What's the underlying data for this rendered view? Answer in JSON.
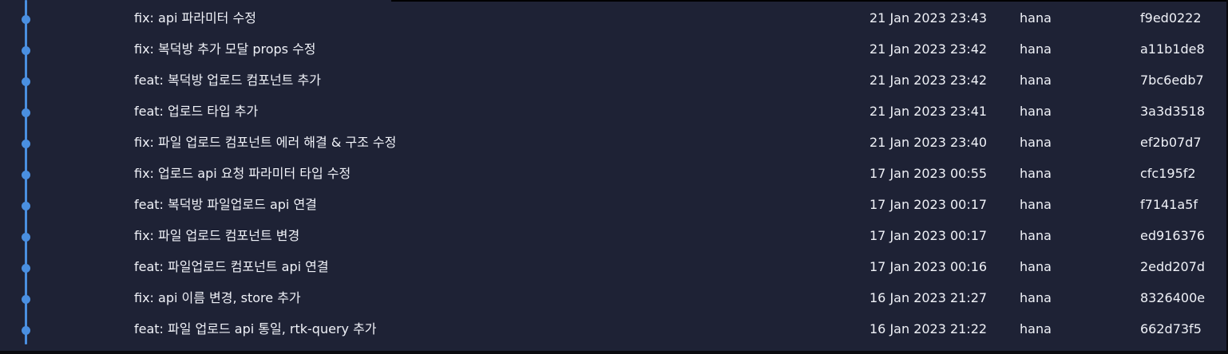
{
  "colors": {
    "background": "#1e2235",
    "graph": "#4a8fe0",
    "text": "#f0f2f8"
  },
  "commits": [
    {
      "message": "fix: api 파라미터 수정",
      "date": "21 Jan 2023 23:43",
      "author": "hana",
      "hash": "f9ed0222"
    },
    {
      "message": "fix: 복덕방 추가 모달 props 수정",
      "date": "21 Jan 2023 23:42",
      "author": "hana",
      "hash": "a11b1de8"
    },
    {
      "message": "feat: 복덕방 업로드 컴포넌트 추가",
      "date": "21 Jan 2023 23:42",
      "author": "hana",
      "hash": "7bc6edb7"
    },
    {
      "message": "feat: 업로드 타입 추가",
      "date": "21 Jan 2023 23:41",
      "author": "hana",
      "hash": "3a3d3518"
    },
    {
      "message": "fix: 파일 업로드 컴포넌트 에러 해결 & 구조 수정",
      "date": "21 Jan 2023 23:40",
      "author": "hana",
      "hash": "ef2b07d7"
    },
    {
      "message": "fix: 업로드 api 요청 파라미터 타입 수정",
      "date": "17 Jan 2023 00:55",
      "author": "hana",
      "hash": "cfc195f2"
    },
    {
      "message": "feat: 복덕방 파일업로드 api 연결",
      "date": "17 Jan 2023 00:17",
      "author": "hana",
      "hash": "f7141a5f"
    },
    {
      "message": "fix: 파일 업로드 컴포넌트 변경",
      "date": "17 Jan 2023 00:17",
      "author": "hana",
      "hash": "ed916376"
    },
    {
      "message": "feat: 파일업로드 컴포넌트 api 연결",
      "date": "17 Jan 2023 00:16",
      "author": "hana",
      "hash": "2edd207d"
    },
    {
      "message": "fix: api 이름 변경, store 추가",
      "date": "16 Jan 2023 21:27",
      "author": "hana",
      "hash": "8326400e"
    },
    {
      "message": "feat: 파일 업로드 api 통일, rtk-query 추가",
      "date": "16 Jan 2023 21:22",
      "author": "hana",
      "hash": "662d73f5"
    }
  ]
}
